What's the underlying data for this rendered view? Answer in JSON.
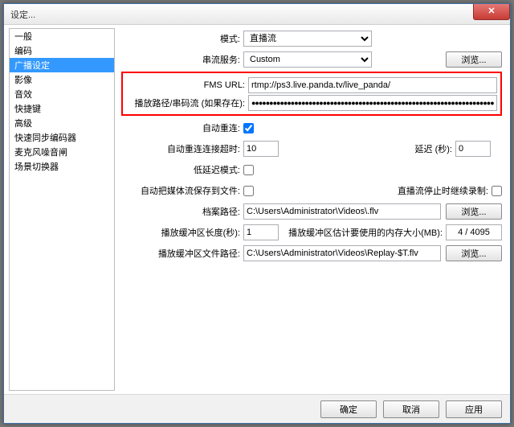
{
  "window": {
    "title": "设定..."
  },
  "sidebar": {
    "items": [
      "一般",
      "编码",
      "广播设定",
      "影像",
      "音效",
      "快捷键",
      "高级",
      "快速同步编码器",
      "麦克风噪音闸",
      "场景切换器"
    ],
    "selected_index": 2
  },
  "form": {
    "mode_label": "模式:",
    "mode_value": "直播流",
    "service_label": "串流服务:",
    "service_value": "Custom",
    "browse": "浏览...",
    "fms_label": "FMS URL:",
    "fms_value": "rtmp://ps3.live.panda.tv/live_panda/",
    "key_label": "播放路径/串码流 (如果存在):",
    "key_value": "●●●●●●●●●●●●●●●●●●●●●●●●●●●●●●●●●●●●●●●●●●●●●●●●●●●●●●●●●●●●●●●●●●●●●●",
    "auto_reconnect_label": "自动重连:",
    "auto_reconnect_checked": true,
    "auto_reconnect_timeout_label": "自动重连连接超时:",
    "auto_reconnect_timeout_value": "10",
    "delay_label": "延迟 (秒):",
    "delay_value": "0",
    "low_latency_label": "低延迟模式:",
    "low_latency_checked": false,
    "auto_save_label": "自动把媒体流保存到文件:",
    "auto_save_checked": false,
    "keep_recording_label": "直播流停止时继续录制:",
    "keep_recording_checked": false,
    "archive_path_label": "档案路径:",
    "archive_path_value": "C:\\Users\\Administrator\\Videos\\.flv",
    "replay_len_label": "播放缓冲区长度(秒):",
    "replay_len_value": "1",
    "replay_mem_label": "播放缓冲区估计要使用的内存大小(MB):",
    "replay_mem_value": "4 / 4095",
    "replay_path_label": "播放缓冲区文件路径:",
    "replay_path_value": "C:\\Users\\Administrator\\Videos\\Replay-$T.flv"
  },
  "footer": {
    "ok": "确定",
    "cancel": "取消",
    "apply": "应用"
  }
}
